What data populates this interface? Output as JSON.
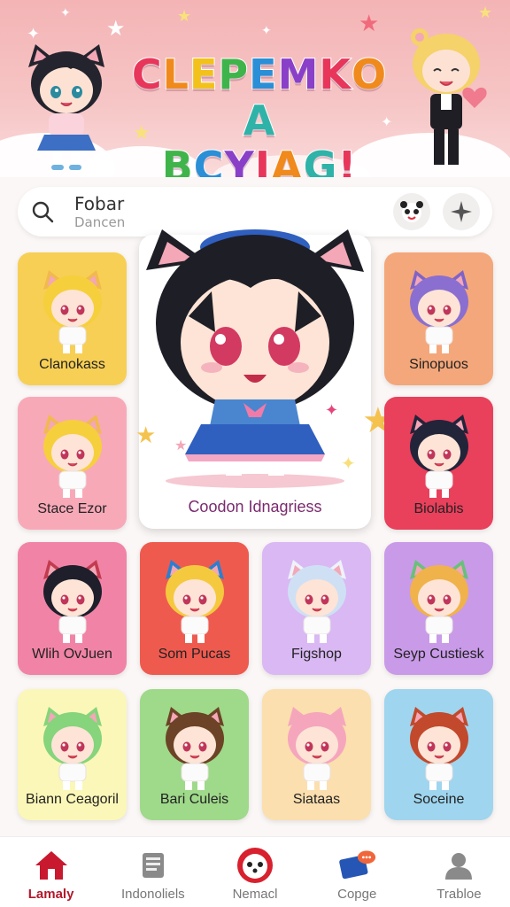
{
  "header": {
    "title_line1": "CLEPEMKOA",
    "title_line2": "BCYIAG!",
    "colors": [
      "#e8365b",
      "#f08a1c",
      "#f2c21a",
      "#3fb44a",
      "#2a8fd6",
      "#8a3fc9",
      "#e8365b",
      "#f08a1c",
      "#2fb3a8"
    ]
  },
  "search": {
    "title": "Fobar",
    "subtitle": "Dancen",
    "icon": "search-icon",
    "action1_icon": "panda-face-icon",
    "action2_icon": "sparkle-icon"
  },
  "featured": {
    "label": "Coodon Idnagriess",
    "icon": "cat-girl-character-icon"
  },
  "tiles": [
    {
      "label": "Clanokass",
      "bg": "#f7cf55",
      "hair": "#f6cf3c",
      "ear": "#f1b94f"
    },
    {
      "label": "Sinopuos",
      "bg": "#f4a77a",
      "hair": "#8a6fd0",
      "ear": "#7f63c6"
    },
    {
      "label": "Stace Ezor",
      "bg": "#f8a9b8",
      "hair": "#f6cf3c",
      "ear": "#f1b94f"
    },
    {
      "label": "Biolabis",
      "bg": "#e9405c",
      "hair": "#22243a",
      "ear": "#22243a"
    },
    {
      "label": "Wlih OvJuen",
      "bg": "#f184a6",
      "hair": "#1f1f2c",
      "ear": "#c23b4f"
    },
    {
      "label": "Som Pucas",
      "bg": "#ef5a4f",
      "hair": "#f5c93e",
      "ear": "#2b7fd1"
    },
    {
      "label": "Figshop",
      "bg": "#d9b8f3",
      "hair": "#cfe0f4",
      "ear": "#eef2fa"
    },
    {
      "label": "Seyp Custiesk",
      "bg": "#c99ae8",
      "hair": "#f0b24a",
      "ear": "#68c07a"
    },
    {
      "label": "Biann Ceagoril",
      "bg": "#fbf7b8",
      "hair": "#86d47c",
      "ear": "#86d47c"
    },
    {
      "label": "Bari Culeis",
      "bg": "#9fd98a",
      "hair": "#6c4326",
      "ear": "#6c4326"
    },
    {
      "label": "Siataas",
      "bg": "#fbdfae",
      "hair": "#f5a6bd",
      "ear": "#f5a6bd"
    },
    {
      "label": "Soceine",
      "bg": "#9fd5ee",
      "hair": "#c2492c",
      "ear": "#c2492c"
    }
  ],
  "nav": [
    {
      "label": "Lamaly",
      "icon": "home-icon",
      "active": true
    },
    {
      "label": "Indonoliels",
      "icon": "document-icon",
      "active": false
    },
    {
      "label": "Nemacl",
      "icon": "panda-badge-icon",
      "active": false
    },
    {
      "label": "Copge",
      "icon": "chat-card-icon",
      "active": false
    },
    {
      "label": "Trabloe",
      "icon": "profile-icon",
      "active": false
    }
  ]
}
